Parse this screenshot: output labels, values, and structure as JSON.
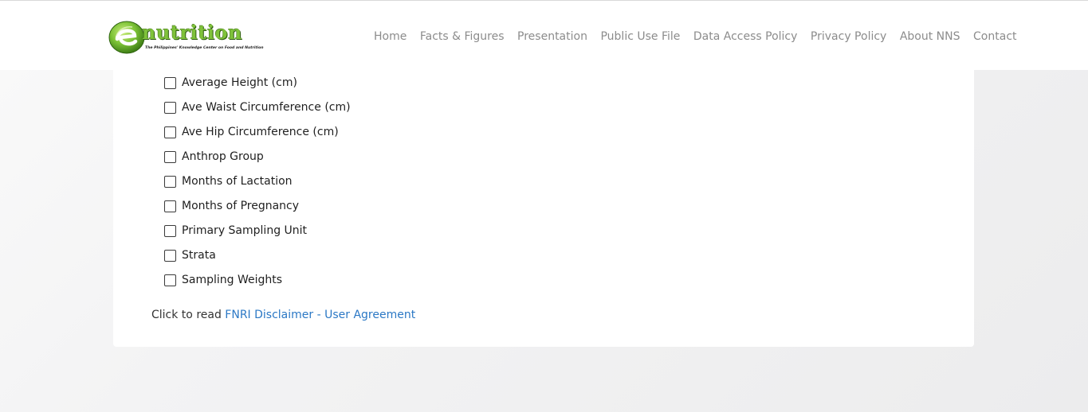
{
  "header": {
    "logo": {
      "wordmark": "nutrition",
      "tagline": "The Philippines' Knowledge Center on Food and Nutrition"
    },
    "nav": [
      {
        "label": "Home"
      },
      {
        "label": "Facts & Figures"
      },
      {
        "label": "Presentation"
      },
      {
        "label": "Public Use File"
      },
      {
        "label": "Data Access Policy"
      },
      {
        "label": "Privacy Policy"
      },
      {
        "label": "About NNS"
      },
      {
        "label": "Contact"
      }
    ]
  },
  "options": [
    {
      "label": "Average Height (cm)",
      "checked": false
    },
    {
      "label": "Ave Waist Circumference (cm)",
      "checked": false
    },
    {
      "label": "Ave Hip Circumference (cm)",
      "checked": false
    },
    {
      "label": "Anthrop Group",
      "checked": false
    },
    {
      "label": "Months of Lactation",
      "checked": false
    },
    {
      "label": "Months of Pregnancy",
      "checked": false
    },
    {
      "label": "Primary Sampling Unit",
      "checked": false
    },
    {
      "label": "Strata",
      "checked": false
    },
    {
      "label": "Sampling Weights",
      "checked": false
    }
  ],
  "disclaimer": {
    "prefix": "Click to read",
    "link_text": "FNRI Disclaimer - User Agreement"
  },
  "colors": {
    "link": "#2b78c5",
    "nav_text": "#8c8c8c",
    "logo_green": "#7fc23a"
  }
}
